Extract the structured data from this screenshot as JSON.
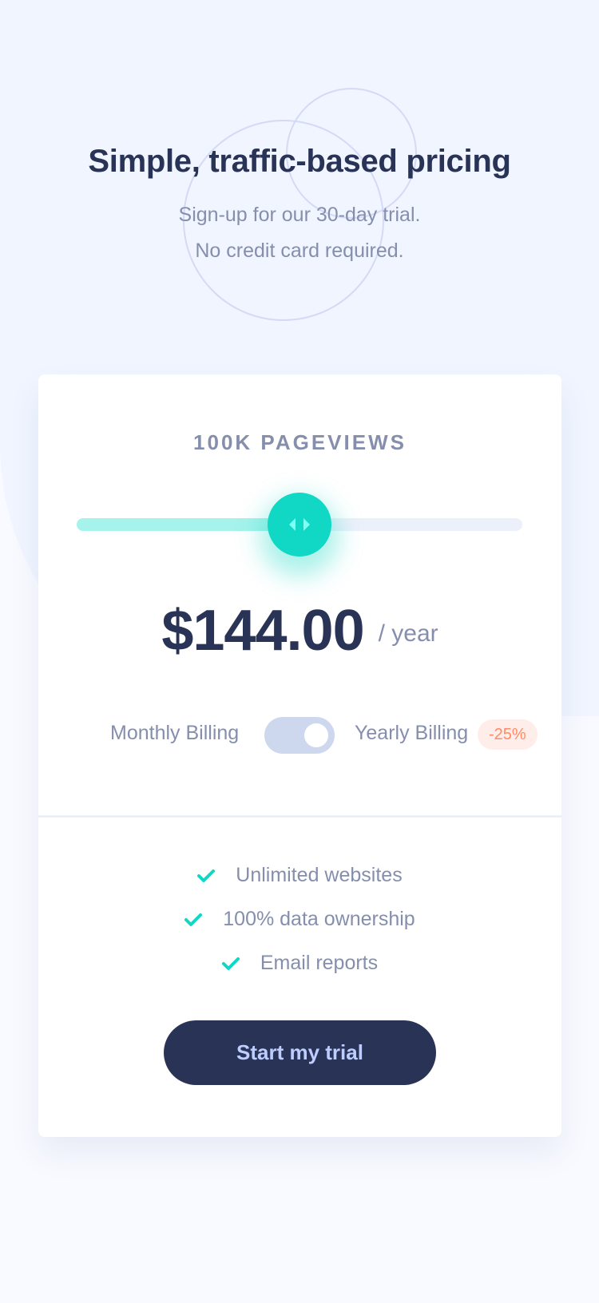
{
  "header": {
    "title": "Simple, traffic-based pricing",
    "subtitle_line1": "Sign-up for our 30-day trial.",
    "subtitle_line2": "No credit card required."
  },
  "card": {
    "pageviews": "100K PAGEVIEWS",
    "slider": {
      "value_fraction": 0.5
    },
    "price": "$144.00",
    "period": "/ year",
    "billing": {
      "monthly_label": "Monthly Billing",
      "yearly_label": "Yearly Billing",
      "discount": "-25%",
      "yearly_selected": true
    },
    "features": [
      {
        "label": "Unlimited websites",
        "icon": "check-icon"
      },
      {
        "label": "100% data ownership",
        "icon": "check-icon"
      },
      {
        "label": "Email reports",
        "icon": "check-icon"
      }
    ],
    "cta_label": "Start my trial"
  },
  "colors": {
    "accent": "#10D8C4",
    "accent_light": "#A5F3EB",
    "dark": "#293356",
    "muted": "#858FAD",
    "discount_text": "#FF8C66",
    "discount_bg": "#FEEDE8",
    "toggle_bg": "#CDD7EE",
    "cta_text": "#BECDFF"
  }
}
